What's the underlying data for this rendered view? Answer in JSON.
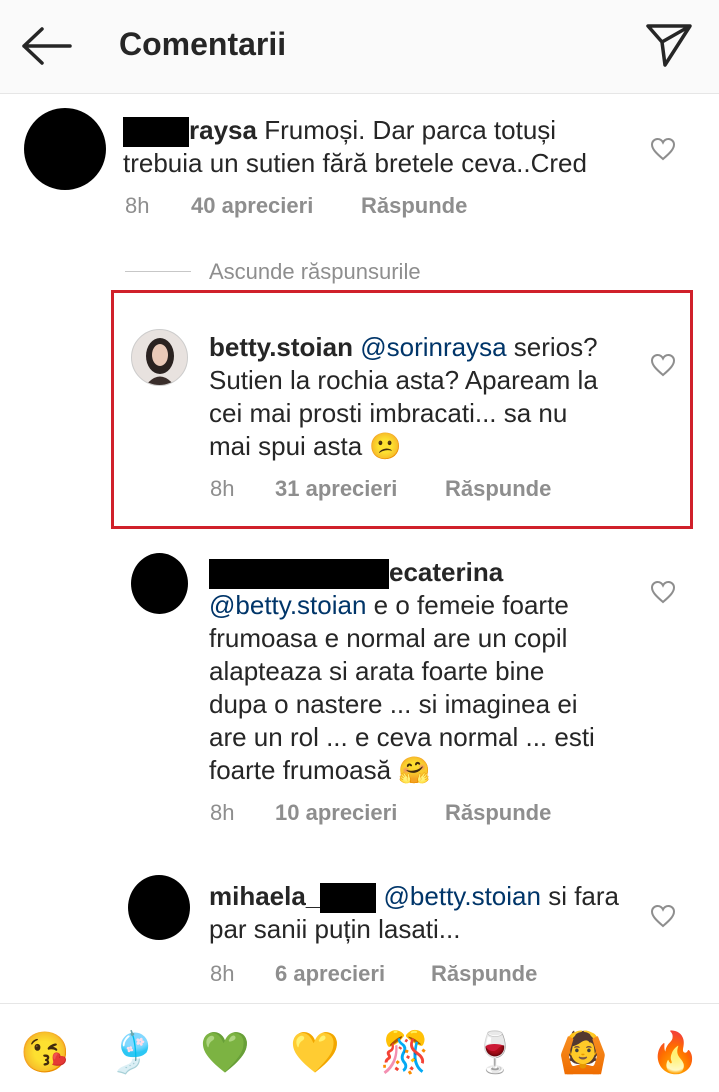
{
  "header": {
    "back_icon": "arrow-left-icon",
    "title": "Comentarii",
    "send_icon": "paper-plane-icon"
  },
  "comments": [
    {
      "username": "raysa",
      "text": "Frumoși. Dar parca totuși trebuia un sutien fără bretele ceva..Cred",
      "line1": "Frumoși. Dar parca totuși",
      "line2": "trebuia un sutien fără bretele ceva..Cred",
      "time": "8h",
      "likes": "40 aprecieri",
      "reply": "Răspunde"
    },
    {
      "username": "betty.stoian",
      "mention": "@sorinraysa",
      "line1_rest": "serios?",
      "line2": "Sutien la rochia asta? Apaream la",
      "line3": "cei mai prosti imbracati... sa nu",
      "line4": "mai spui asta 😕",
      "time": "8h",
      "likes": "31 aprecieri",
      "reply": "Răspunde"
    },
    {
      "username": "ecaterina",
      "mention": "@betty.stoian",
      "line1_rest": " e o femeie foarte",
      "line2": "frumoasa e normal are un copil",
      "line3": "alapteaza si arata foarte bine",
      "line4": "dupa o nastere ... si imaginea ei",
      "line5": "are un rol ... e ceva normal ... esti",
      "line6": "foarte frumoasă 🤗",
      "time": "8h",
      "likes": "10 aprecieri",
      "reply": "Răspunde"
    },
    {
      "username": "mihaela_",
      "mention": "@betty.stoian",
      "line1_rest": "si fara",
      "line2": "par sanii puțin lasati...",
      "time": "8h",
      "likes": "6 aprecieri",
      "reply": "Răspunde"
    }
  ],
  "hide_replies": "Ascunde răspunsurile",
  "emoji_bar": [
    "😘",
    "🎐",
    "💚",
    "💛",
    "🎊",
    "🍷",
    "🙆",
    "🔥"
  ],
  "colors": {
    "highlight": "#d0202a",
    "mention": "#003569",
    "meta": "#8e8e8e"
  }
}
